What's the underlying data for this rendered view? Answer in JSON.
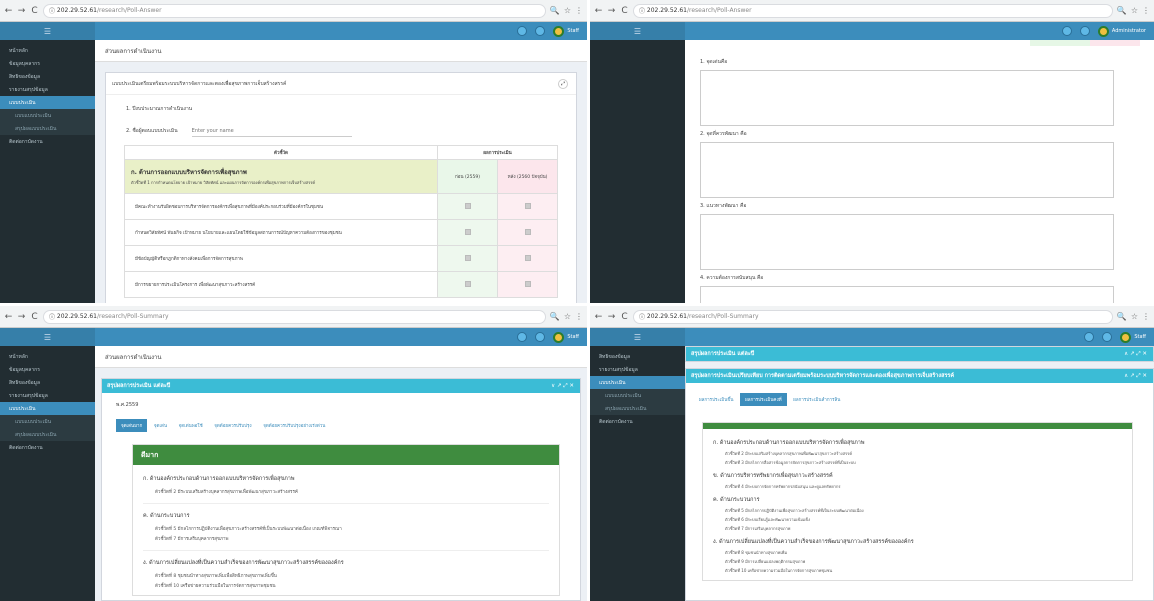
{
  "browser_url_host": "202.29.52.61",
  "q1": {
    "url_path": "/research/Poll-Answer",
    "user": "Staff",
    "sidebar": [
      "หน้าหลัก",
      "ข้อมูลบุคลากร",
      "สิทธิของข้อมูล",
      "รายงานสรุปข้อมูล",
      "แบบประเมิน",
      "แบบแบบประเมิน",
      "สรุปผลแบบประเมิน",
      "ติดต่อกาบัดงาน"
    ],
    "header": "ส่วนผลการดำเนินงาน",
    "box_title": "แบบประเมินเตรียมพร้อมระบบบริหารจัดการและตองเพื่อสุขภาพการเจ็บสร้างสรรค์",
    "field1_label": "1. ปีงบประมาณการดำเนินงาน",
    "field2_label": "2. ชื่อผู้ตอบแบบประเมิน",
    "field2_placeholder": "Enter your name",
    "table_headers": [
      "ตัวชี้วัด",
      "ผลการประเมิน"
    ],
    "section_title": "ก. ด้านการออกแบบบริหารจัดการเพื่อสุขภาพ",
    "section_sub": "ตัวชี้วัดที่ 1 การกำหนดนโยบาย เป้าหมาย วิสัยทัศน์ และแผนการจัดการองค์กรเพื่อสุขภาพการเจ็บสร้างสรรค์",
    "col_before": "ก่อน (2559)",
    "col_after": "หลัง (2560 ปัจจุบัน)",
    "rows": [
      "มีคณะทำงานรับผิดชอบการบริหารจัดการองค์กรเพื่อสุขภาพที่มีองค์ประกอบร่วมที่มีองค์กรในชุมชน",
      "กำหนดวิสัยทัศน์ พันธกิจ เป้าหมาย นโยบายและแผนโดยใช้ข้อมูลสถานการณ์ปัญหาความต้องการของชุมชน",
      "มีข้อบัญญัติหรือกฎกติกาทางสังคมเพื่อการจัดการสุขภาพ",
      "มีการขยายการประเมินโครงการ เพื่อพัฒนาสุขภาวะสร้างสรรค์"
    ]
  },
  "q2": {
    "url_path": "/research/Poll-Answer",
    "user": "Administrator",
    "questions": [
      "1. จุดเด่นคือ",
      "2. จุดที่ควรพัฒนา คือ",
      "3. แนวทางพัฒนา คือ",
      "4. ความต้องการสนับสนุน คือ"
    ]
  },
  "q3": {
    "url_path": "/research/Poll-Summary",
    "user": "Staff",
    "sidebar": [
      "หน้าหลัก",
      "ข้อมูลบุคลากร",
      "สิทธิของข้อมูล",
      "รายงานสรุปข้อมูล",
      "แบบประเมิน",
      "แบบแบบประเมิน",
      "สรุปผลแบบประเมิน",
      "ติดต่อกาบัดงาน"
    ],
    "header": "ส่วนผลการดำเนินงาน",
    "box_title": "สรุปผลการประเมิน แต่ละปี",
    "year": "พ.ศ.2559",
    "tabs": [
      "จุดเด่นมาก",
      "จุดเด่น",
      "จุดเด่นพอใช้",
      "จุดด้อยควรปรับปรุง",
      "จุดด้อยควรปรับปรุงอย่างเร่งด่วน"
    ],
    "section": "ดีมาก",
    "items": [
      {
        "title": "ก. ด้านองค์กรประกอบด้านการออกแบบบริหารจัดการเพื่อสุขภาพ",
        "subs": [
          "ตัวชี้วัดที่ 2 มีระบบเสริมสร้างบุคลากรสุขภาพเพื่อพัฒนาสุขภาวะสร้างสรรค์"
        ]
      },
      {
        "title": "ค. ด้านกระบวนการ",
        "subs": [
          "ตัวชี้วัดที่ 5 มีกลไกการปฏิบัติงานเพื่อสุขภาวะสร้างสรรค์ที่เป็นระบบพัฒนาต่อเนื่อง เกณฑ์พิจารณา",
          "ตัวชี้วัดที่ 7 มีการเสริมบุคลากรสุขภาพ"
        ]
      },
      {
        "title": "ง. ด้านการเปลี่ยนแปลงที่เป็นความสำเร็จของการพัฒนาสุขภาวะสร้างสรรค์ขององค์กร",
        "subs": [
          "ตัวชี้วัดที่ 8 ชุมชนนำทางสุขภาพเพิ่มเพื่อสิทธิภาพสุขภาพเพิ่มขึ้น",
          "ตัวชี้วัดที่ 10 เครือข่ายความร่วมมือในการจัดการสุขภาพชุมชน"
        ]
      }
    ]
  },
  "q4": {
    "url_path": "/research/Poll-Summary",
    "user": "Staff",
    "sidebar": [
      "สิทธิของข้อมูล",
      "รายงานสรุปข้อมูล",
      "แบบประเมิน",
      "แบบแบบประเมิน",
      "สรุปผลแบบประเมิน",
      "ติดต่อกาบัดงาน"
    ],
    "box1_title": "สรุปผลการประเมิน แต่ละปี",
    "box2_title": "สรุปผลการประเมินเปรียบเทียบ การติดตามเตรียมพร้อมระบบบริหารจัดการและตองเพื่อสุขภาพการเจ็บสร้างสรรค์",
    "tabs": [
      "ผลการประเมินขึ้น",
      "ผลการประเมินคงที่",
      "ผลการประเมินลำการลิน"
    ],
    "items": [
      {
        "title": "ก. ด้านองค์กรประกอบด้านการออกแบบบริหารจัดการเพื่อสุขภาพ",
        "subs": [
          "ตัวชี้วัดที่ 2 มีระบบเสริมสร้างบุคลากรสุขภาพเพื่อพัฒนาสุขภาวะสร้างสรรค์",
          "ตัวชี้วัดที่ 3 มีกลไกการสื่อสารข้อมูลการจัดการสุขภาวะสร้างสรรค์ที่เป็นระบบ"
        ]
      },
      {
        "title": "ข. ด้านการบริหารทรัพยากรเพื่อสุขภาวะสร้างสรรค์",
        "subs": [
          "ตัวชี้วัดที่ 4 มีระบบการจัดการทรัพยากรสนับสนุน และดูแลทรัพยากร"
        ]
      },
      {
        "title": "ค. ด้านกระบวนการ",
        "subs": [
          "ตัวชี้วัดที่ 5 มีกลไกการปฏิบัติงานเพื่อสุขภาวะสร้างสรรค์ที่เป็นระบบพัฒนาต่อเนื่อง",
          "ตัวชี้วัดที่ 6 มีระบบเรียนรู้และพัฒนาความเข้มแข็ง",
          "ตัวชี้วัดที่ 7 มีการเสริมบุคลากรสุขภาพ"
        ]
      },
      {
        "title": "ง. ด้านการเปลี่ยนแปลงที่เป็นความสำเร็จของการพัฒนาสุขภาวะสร้างสรรค์ขององค์กร",
        "subs": [
          "ตัวชี้วัดที่ 8 ชุมชนนำทางสุขภาพเพิ่ม",
          "ตัวชี้วัดที่ 9 มีการเปลี่ยนแปลงพฤติกรรมสุขภาพ",
          "ตัวชี้วัดที่ 10 เครือข่ายความร่วมมือในการจัดการสุขภาพชุมชน"
        ]
      }
    ]
  }
}
